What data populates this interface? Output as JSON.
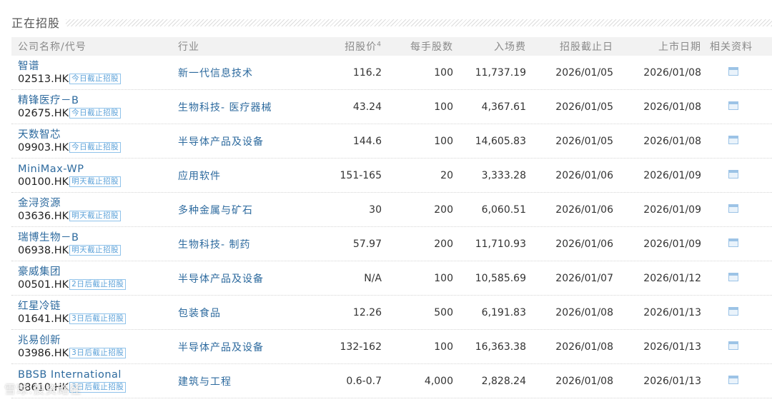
{
  "section": {
    "title": "正在招股"
  },
  "headers": {
    "name": "公司名称/代号",
    "industry": "行业",
    "price": "招股价",
    "price_sup": "4",
    "lot": "每手股数",
    "fee": "入场费",
    "close": "招股截止日",
    "list": "上市日期",
    "docs": "相关资料"
  },
  "rows": [
    {
      "name": "智谱",
      "code": "02513.HK",
      "badge": "今日截止招股",
      "industry": "新一代信息技术",
      "price": "116.2",
      "lot": "100",
      "fee": "11,737.19",
      "close": "2026/01/05",
      "list": "2026/01/08"
    },
    {
      "name": "精锋医疗－B",
      "code": "02675.HK",
      "badge": "今日截止招股",
      "industry": "生物科技- 医疗器械",
      "price": "43.24",
      "lot": "100",
      "fee": "4,367.61",
      "close": "2026/01/05",
      "list": "2026/01/08"
    },
    {
      "name": "天数智芯",
      "code": "09903.HK",
      "badge": "今日截止招股",
      "industry": "半导体产品及设备",
      "price": "144.6",
      "lot": "100",
      "fee": "14,605.83",
      "close": "2026/01/05",
      "list": "2026/01/08"
    },
    {
      "name": "MiniMax-WP",
      "code": "00100.HK",
      "badge": "明天截止招股",
      "industry": "应用软件",
      "price": "151-165",
      "lot": "20",
      "fee": "3,333.28",
      "close": "2026/01/06",
      "list": "2026/01/09"
    },
    {
      "name": "金浔资源",
      "code": "03636.HK",
      "badge": "明天截止招股",
      "industry": "多种金属与矿石",
      "price": "30",
      "lot": "200",
      "fee": "6,060.51",
      "close": "2026/01/06",
      "list": "2026/01/09"
    },
    {
      "name": "瑞博生物－B",
      "code": "06938.HK",
      "badge": "明天截止招股",
      "industry": "生物科技- 制药",
      "price": "57.97",
      "lot": "200",
      "fee": "11,710.93",
      "close": "2026/01/06",
      "list": "2026/01/09"
    },
    {
      "name": "豪威集团",
      "code": "00501.HK",
      "badge": "2日后截止招股",
      "industry": "半导体产品及设备",
      "price": "N/A",
      "lot": "100",
      "fee": "10,585.69",
      "close": "2026/01/07",
      "list": "2026/01/12"
    },
    {
      "name": "红星冷链",
      "code": "01641.HK",
      "badge": "3日后截止招股",
      "industry": "包装食品",
      "price": "12.26",
      "lot": "500",
      "fee": "6,191.83",
      "close": "2026/01/08",
      "list": "2026/01/13"
    },
    {
      "name": "兆易创新",
      "code": "03986.HK",
      "badge": "3日后截止招股",
      "industry": "半导体产品及设备",
      "price": "132-162",
      "lot": "100",
      "fee": "16,363.38",
      "close": "2026/01/08",
      "list": "2026/01/13"
    },
    {
      "name": "BBSB International",
      "code": "08610.HK",
      "badge": "3日后截止招股",
      "industry": "建筑与工程",
      "price": "0.6-0.7",
      "lot": "4,000",
      "fee": "2,828.24",
      "close": "2026/01/08",
      "list": "2026/01/13"
    }
  ],
  "watermark": "雪球:投资路径"
}
